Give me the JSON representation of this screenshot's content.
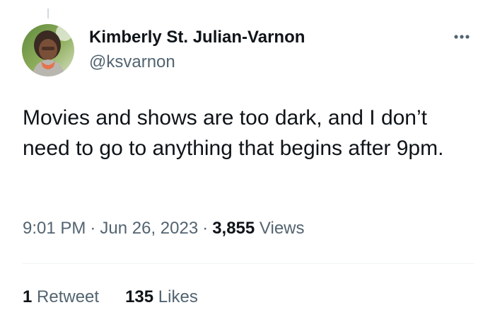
{
  "author": {
    "display_name": "Kimberly St. Julian-Varnon",
    "handle": "@ksvarnon"
  },
  "tweet": {
    "text": "Movies and shows are too dark, and I don’t need to go to anything that begins after 9pm.",
    "time": "9:01 PM",
    "separator": "·",
    "date": "Jun 26, 2023",
    "views_count": "3,855",
    "views_label": "Views"
  },
  "stats": {
    "retweets_count": "1",
    "retweets_label": "Retweet",
    "likes_count": "135",
    "likes_label": "Likes"
  },
  "icons": {
    "more": "more-horizontal-icon"
  },
  "colors": {
    "text_primary": "#0f1419",
    "text_secondary": "#536471",
    "divider": "#eff3f4"
  }
}
